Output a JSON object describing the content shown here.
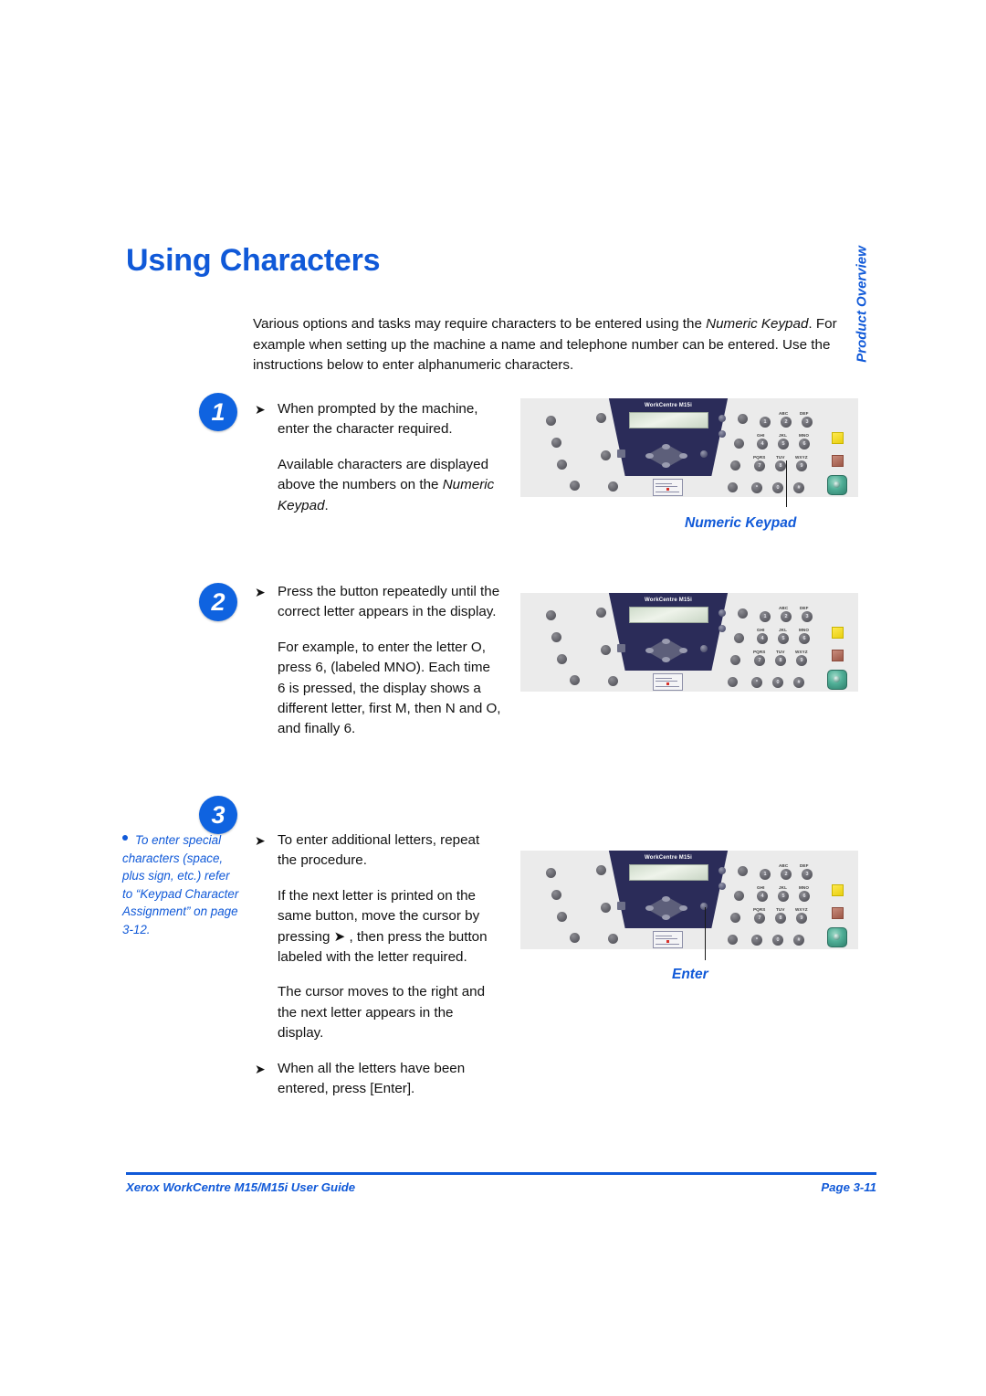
{
  "document": {
    "title": "Using Characters",
    "chapter_tab": "Product Overview"
  },
  "intro": {
    "line1_a": "Various options and tasks may require characters to be entered using the ",
    "line1_em": "Numeric Keypad",
    "line1_b": ". For example when setting up the machine a name and telephone number can be entered. Use the instructions below to enter alphanumeric characters."
  },
  "steps": [
    {
      "badge": "1",
      "arrow_glyph": "➤",
      "bullet": "When prompted by the machine, enter the character required.",
      "para_a": "Available characters are displayed above the numbers on the ",
      "para_em": "Numeric Keypad",
      "para_b": "."
    },
    {
      "badge": "2",
      "arrow_glyph": "➤",
      "bullet": "Press the button repeatedly until the correct letter appears in the display.",
      "para2": "For example, to enter the letter O, press 6, (labeled MNO). Each time 6 is pressed, the display shows a different letter, first M, then N and O, and finally 6."
    },
    {
      "badge": "3",
      "arrow_glyph": "➤",
      "bullet": "To enter additional letters, repeat the procedure.",
      "para_a": "If the next letter is printed on the same button, move the cursor by pressing ",
      "para_arrow": "➤",
      "para_b": " , then press the button labeled with the letter required.",
      "para3": "The cursor moves to the right and the next letter appears in the display.",
      "bullet2": "When all the letters have been entered, press [Enter]."
    }
  ],
  "margin_note": {
    "text_a": "To enter special characters (space, plus sign, etc.) refer to “Keypad Character Assignment” on page 3-12."
  },
  "figures": [
    {
      "brand": "WorkCentre M15i",
      "caption": "Numeric Keypad",
      "has_leader": true
    },
    {
      "brand": "WorkCentre M15i",
      "caption": "",
      "has_leader": false
    },
    {
      "brand": "WorkCentre M15i",
      "caption": "Enter",
      "has_leader": true
    }
  ],
  "keypad": {
    "keys": [
      {
        "digit": "1",
        "letters": ""
      },
      {
        "digit": "2",
        "letters": "ABC"
      },
      {
        "digit": "3",
        "letters": "DEF"
      },
      {
        "digit": "4",
        "letters": "GHI"
      },
      {
        "digit": "5",
        "letters": "JKL"
      },
      {
        "digit": "6",
        "letters": "MNO"
      },
      {
        "digit": "7",
        "letters": "PQRS"
      },
      {
        "digit": "8",
        "letters": "TUV"
      },
      {
        "digit": "9",
        "letters": "WXYZ"
      },
      {
        "digit": "*",
        "letters": ""
      },
      {
        "digit": "0",
        "letters": ""
      },
      {
        "digit": "#",
        "letters": ""
      }
    ]
  },
  "footer": {
    "left": "Xerox WorkCentre M15/M15i User Guide",
    "right": "Page 3-11"
  },
  "colors": {
    "accent_blue": "#1059d8",
    "badge_blue": "#0f63e0",
    "panel_gray": "#ebebeb",
    "panel_navy": "#2b2c59"
  }
}
